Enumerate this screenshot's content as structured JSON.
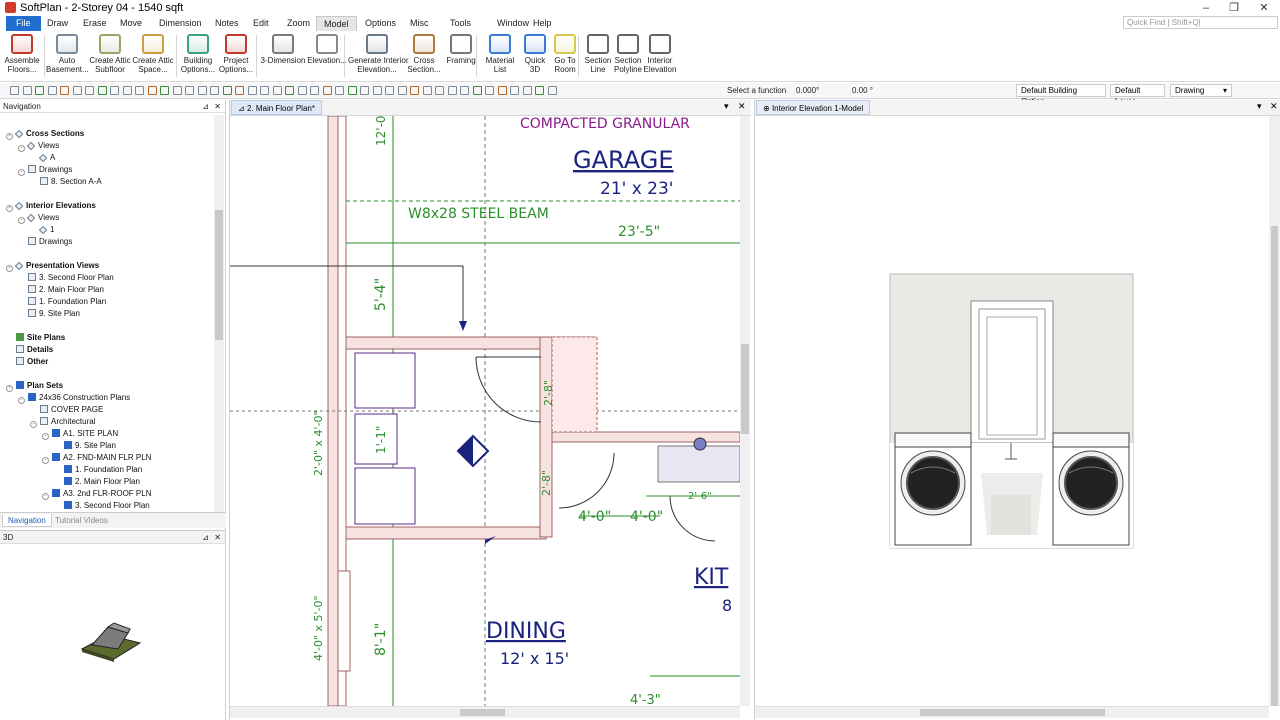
{
  "window": {
    "title": "SoftPlan - 2-Storey 04 - 1540 sqft",
    "min": "–",
    "restore": "❐",
    "close": "✕"
  },
  "menu": [
    "File",
    "Draw",
    "Erase",
    "Move",
    "Dimension",
    "Notes",
    "Edit",
    "Zoom",
    "Model",
    "Options",
    "Misc",
    "Tools",
    "Window",
    "Help"
  ],
  "quick_find": {
    "placeholder": "Quick Find | Shift+Q|"
  },
  "ribbon": [
    {
      "label": "Assemble\nFloors...",
      "icon": "assemble-floors-icon",
      "color": "#c0392b"
    },
    {
      "label": "Auto\nBasement...",
      "icon": "auto-basement-icon",
      "color": "#7a8a99"
    },
    {
      "label": "Create Attic\nSubfloor",
      "icon": "attic-subfloor-icon",
      "color": "#9aa36a"
    },
    {
      "label": "Create Attic\nSpace...",
      "icon": "attic-space-icon",
      "color": "#c9a040"
    },
    {
      "label": "Building\nOptions...",
      "icon": "building-options-icon",
      "color": "#3aa37c"
    },
    {
      "label": "Project\nOptions...",
      "icon": "project-options-icon",
      "color": "#c0392b"
    },
    {
      "label": "3-Dimension",
      "icon": "3d-house-icon",
      "color": "#7a7a7a"
    },
    {
      "label": "Elevation...",
      "icon": "elevation-icon",
      "color": "#888"
    },
    {
      "label": "Generate Interior\nElevation...",
      "icon": "generate-interior-elevation-icon",
      "color": "#6a7a8a"
    },
    {
      "label": "Cross\nSection...",
      "icon": "cross-section-icon",
      "color": "#b07a40"
    },
    {
      "label": "Framing",
      "icon": "framing-icon",
      "color": "#777"
    },
    {
      "label": "Material\nList",
      "icon": "material-list-icon",
      "color": "#3a7bd5"
    },
    {
      "label": "Quick\n3D",
      "icon": "quick-3d-icon",
      "color": "#3a7bd5"
    },
    {
      "label": "Go To\nRoom",
      "icon": "go-to-room-icon",
      "color": "#d4c94a"
    },
    {
      "label": "Section\nLine",
      "icon": "section-line-icon",
      "color": "#666"
    },
    {
      "label": "Section\nPolyline",
      "icon": "section-polyline-icon",
      "color": "#666"
    },
    {
      "label": "Interior\nElevation",
      "icon": "interior-elevation-icon",
      "color": "#666"
    }
  ],
  "toolbar2": {
    "function_label": "Select a function",
    "angle1": "0.000°",
    "angle2": "0.00 °",
    "building_option": "Default Building Option",
    "layer": "Default Layer",
    "mode": "Drawing"
  },
  "navigation": {
    "title": "Navigation",
    "tree": [
      {
        "label": "Cross Sections",
        "level": 0,
        "bold": true,
        "icon": "cross-sections-icon",
        "expander": "-"
      },
      {
        "label": "Views",
        "level": 1,
        "icon": "views-icon",
        "expander": "-"
      },
      {
        "label": "A",
        "level": 2,
        "icon": "view-a-icon"
      },
      {
        "label": "Drawings",
        "level": 1,
        "icon": "drawings-icon",
        "expander": "-"
      },
      {
        "label": "8. Section A-A",
        "level": 2,
        "icon": "drawing-icon"
      },
      {
        "label": "",
        "level": 0
      },
      {
        "label": "Interior Elevations",
        "level": 0,
        "bold": true,
        "icon": "interior-elevations-icon",
        "expander": "-"
      },
      {
        "label": "Views",
        "level": 1,
        "icon": "views-icon",
        "expander": "-"
      },
      {
        "label": "1",
        "level": 2,
        "icon": "elevation-view-icon"
      },
      {
        "label": "Drawings",
        "level": 1,
        "icon": "drawings-icon"
      },
      {
        "label": "",
        "level": 0
      },
      {
        "label": "Presentation Views",
        "level": 0,
        "bold": true,
        "icon": "presentation-views-icon",
        "expander": "-"
      },
      {
        "label": "3. Second Floor Plan",
        "level": 1,
        "icon": "floor-plan-icon"
      },
      {
        "label": "2. Main Floor Plan",
        "level": 1,
        "icon": "floor-plan-icon"
      },
      {
        "label": "1. Foundation Plan",
        "level": 1,
        "icon": "floor-plan-icon"
      },
      {
        "label": "9. Site Plan",
        "level": 1,
        "icon": "floor-plan-icon"
      },
      {
        "label": "",
        "level": 0
      },
      {
        "label": "Site Plans",
        "level": 0,
        "bold": true,
        "icon": "site-plans-icon"
      },
      {
        "label": "Details",
        "level": 0,
        "bold": true,
        "icon": "details-icon"
      },
      {
        "label": "Other",
        "level": 0,
        "bold": true,
        "icon": "other-icon"
      },
      {
        "label": "",
        "level": 0
      },
      {
        "label": "Plan Sets",
        "level": 0,
        "bold": true,
        "icon": "plan-sets-icon",
        "expander": "-"
      },
      {
        "label": "24x36 Construction Plans",
        "level": 1,
        "icon": "plan-set-icon",
        "expander": "-"
      },
      {
        "label": "COVER PAGE",
        "level": 2,
        "icon": "page-icon"
      },
      {
        "label": "Architectural",
        "level": 2,
        "icon": "folder-icon",
        "expander": "-"
      },
      {
        "label": "A1. SITE PLAN",
        "level": 3,
        "icon": "sheet-icon",
        "expander": "-"
      },
      {
        "label": "9. Site Plan",
        "level": 4,
        "icon": "sheet-view-icon"
      },
      {
        "label": "A2. FND-MAIN FLR PLN",
        "level": 3,
        "icon": "sheet-icon",
        "expander": "-"
      },
      {
        "label": "1. Foundation Plan",
        "level": 4,
        "icon": "sheet-view-icon"
      },
      {
        "label": "2. Main Floor Plan",
        "level": 4,
        "icon": "sheet-view-icon"
      },
      {
        "label": "A3. 2nd FLR-ROOF PLN",
        "level": 3,
        "icon": "sheet-icon",
        "expander": "-"
      },
      {
        "label": "3. Second Floor Plan",
        "level": 4,
        "icon": "sheet-view-icon"
      }
    ],
    "tabs": [
      "Navigation",
      "Tutorial Videos"
    ]
  },
  "panel_3d": {
    "title": "3D"
  },
  "plan_tab": {
    "label": "2. Main Floor Plan*"
  },
  "elev_tab": {
    "label": "Interior Elevation 1-Model"
  },
  "plan_text": {
    "garage_top": "COMPACTED GRANULAR",
    "garage": "GARAGE",
    "garage_dim": "21' x 23'",
    "beam": "W8x28 STEEL BEAM",
    "beam_dim": "23'-5\"",
    "dim_12": "12'-0",
    "dim_54": "5'-4\"",
    "dim_28a": "2'-8\"",
    "dim_28b": "2'-8\"",
    "dim_11": "1'-1\"",
    "dim_40a": "4'-0\"",
    "dim_40b": "4'-0\"",
    "dim_26": "2'-6\"",
    "dim_24": "2'-0\" x 4'-0\"",
    "dim_25": "4'-0\" x 5'-0\"",
    "dim_81": "8'-1\"",
    "dim_43": "4'-3\"",
    "kitchen": "KIT",
    "kitchen_dim": "8",
    "dining": "DINING",
    "dining_dim": "12' x 15'"
  }
}
